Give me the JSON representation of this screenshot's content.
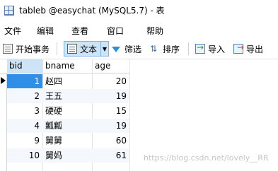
{
  "window": {
    "title": "tableb @easychat (MySQL5.7) - 表"
  },
  "menu": {
    "items": [
      "文件",
      "编辑",
      "查看",
      "窗口",
      "帮助"
    ]
  },
  "toolbar": {
    "begin_transaction": "开始事务",
    "text": "文本",
    "filter": "筛选",
    "sort": "排序",
    "import": "导入",
    "export": "导出"
  },
  "table": {
    "columns": [
      "bid",
      "bname",
      "age"
    ],
    "rows": [
      {
        "bid": "1",
        "bname": "赵四",
        "age": "20"
      },
      {
        "bid": "2",
        "bname": "王五",
        "age": "19"
      },
      {
        "bid": "3",
        "bname": "硬硬",
        "age": "15"
      },
      {
        "bid": "4",
        "bname": "瓤瓤",
        "age": "19"
      },
      {
        "bid": "9",
        "bname": "舅舅",
        "age": "60"
      },
      {
        "bid": "10",
        "bname": "舅妈",
        "age": "61"
      }
    ]
  },
  "watermark": "https://blog.csdn.net/lovely__RR"
}
